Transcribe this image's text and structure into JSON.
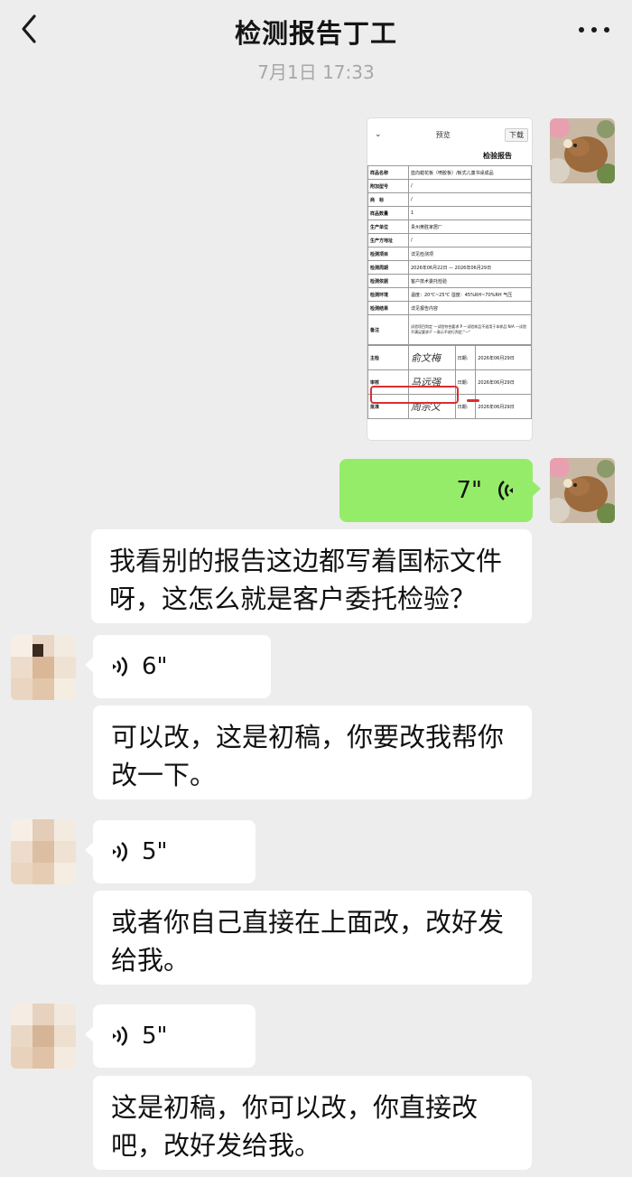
{
  "header": {
    "title": "检测报告丁工"
  },
  "timestamp": "7月1日 17:33",
  "doc_preview": {
    "preview_label": "预览",
    "download_label": "下载",
    "report_title": "检验报告",
    "rows": [
      {
        "k": "样品名称",
        "v": "蓝向蜡花板（喷胶板）/板式儿童书桌成品"
      },
      {
        "k": "附加型号",
        "v": "/"
      },
      {
        "k": "商　标",
        "v": "/"
      },
      {
        "k": "样品数量",
        "v": "1"
      },
      {
        "k": "生产单位",
        "v": "贵州黄胜家居厂"
      },
      {
        "k": "生产方地址",
        "v": "/"
      },
      {
        "k": "检测项目",
        "v": "详见检测项"
      },
      {
        "k": "检测周期",
        "v": "2026年06月22日 — 2026年06月29日"
      },
      {
        "k": "检测依据",
        "v": "客户技术委托检验"
      },
      {
        "k": "检测环境",
        "v": "温度：20℃~25℃ 湿度：45%RH~70%RH 气压"
      },
      {
        "k": "检测结果",
        "v": "详见报告内容"
      },
      {
        "k": "备注",
        "v": "试验项目判定 —试验符合要求:P —试验样品不适用于本样品:N/A —试验不满足要求:F —表示不进行判定:\"—\""
      }
    ],
    "signatures": [
      {
        "k": "主检",
        "sig": "俞文梅",
        "date_label": "日期:",
        "date": "2026年06月29日"
      },
      {
        "k": "审核",
        "sig": "马远强",
        "date_label": "日期:",
        "date": "2026年06月29日"
      },
      {
        "k": "批准",
        "sig": "周宗义",
        "date_label": "日期:",
        "date": "2026年06月29日"
      }
    ]
  },
  "messages": [
    {
      "type": "voice",
      "side": "right",
      "duration": "7\""
    },
    {
      "type": "text",
      "side": "left",
      "text": "我看别的报告这边都写着国标文件呀，这怎么就是客户委托检验？"
    },
    {
      "type": "voice",
      "side": "left",
      "duration": "6\""
    },
    {
      "type": "text",
      "side": "left",
      "text": "可以改，这是初稿，你要改我帮你改一下。"
    },
    {
      "type": "voice",
      "side": "left",
      "duration": "5\""
    },
    {
      "type": "text",
      "side": "left",
      "text": "或者你自己直接在上面改，改好发给我。"
    },
    {
      "type": "voice",
      "side": "left",
      "duration": "5\""
    },
    {
      "type": "text",
      "side": "left",
      "text": "这是初稿，你可以改，你直接改吧，改好发给我。"
    }
  ],
  "colors": {
    "background": "#ededed",
    "self_bubble": "#95ec69",
    "other_bubble": "#ffffff",
    "highlight": "#d83030"
  },
  "icons": {
    "back": "chevron-left-icon",
    "more": "more-dots-icon",
    "voice": "voice-wave-icon"
  }
}
